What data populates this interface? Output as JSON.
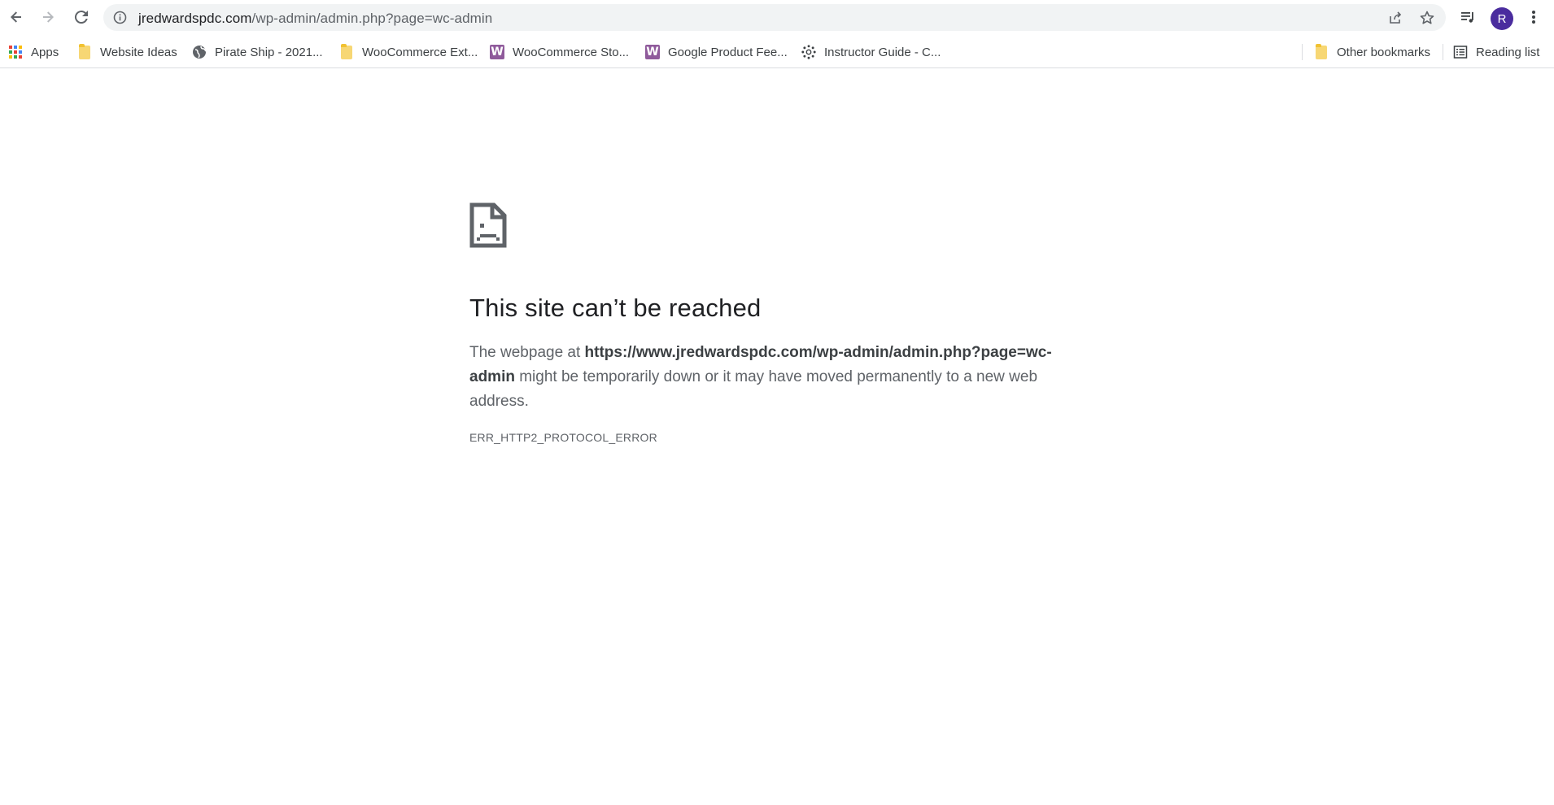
{
  "toolbar": {
    "back_icon": "arrow-left-icon",
    "forward_icon": "arrow-right-icon",
    "reload_icon": "reload-icon",
    "address": {
      "host": "jredwardspdc.com",
      "path": "/wp-admin/admin.php?page=wc-admin"
    },
    "profile_initial": "R"
  },
  "bookmarks": {
    "items": [
      {
        "label": "Apps",
        "icon": "apps-grid-icon"
      },
      {
        "label": "Website Ideas",
        "icon": "folder-icon"
      },
      {
        "label": "Pirate Ship - 2021...",
        "icon": "globe-icon"
      },
      {
        "label": "WooCommerce Ext...",
        "icon": "folder-icon"
      },
      {
        "label": "WooCommerce Sto...",
        "icon": "woocommerce-icon"
      },
      {
        "label": "Google Product Fee...",
        "icon": "woocommerce-icon"
      },
      {
        "label": "Instructor Guide - C...",
        "icon": "canvas-icon"
      }
    ],
    "other_label": "Other bookmarks",
    "reading_list_label": "Reading list"
  },
  "error": {
    "title": "This site can’t be reached",
    "desc_prefix": "The webpage at ",
    "url": "https://www.jredwardspdc.com/wp-admin/admin.php?page=wc-admin",
    "desc_suffix": " might be temporarily down or it may have moved permanently to a new web address.",
    "code": "ERR_HTTP2_PROTOCOL_ERROR"
  },
  "colors": {
    "avatar": "#4a2c9e",
    "woocommerce": "#8f5a9b",
    "folder": "#f7d774"
  }
}
